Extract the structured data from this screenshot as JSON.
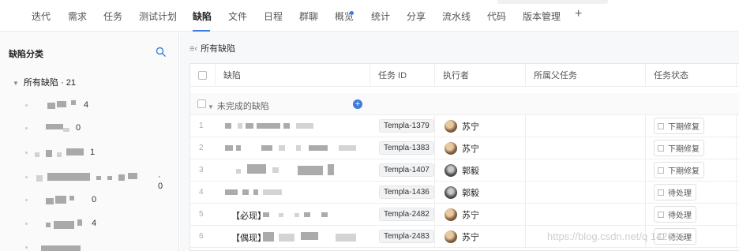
{
  "nav": {
    "tabs": [
      "迭代",
      "需求",
      "任务",
      "测试计划",
      "缺陷",
      "文件",
      "日程",
      "群聊",
      "概览",
      "统计",
      "分享",
      "流水线",
      "代码",
      "版本管理"
    ],
    "active_tab": "缺陷",
    "add_label": "+",
    "accent": "#3d7be0"
  },
  "sidebar": {
    "title": "缺陷分类",
    "all_label": "所有缺陷 · 21",
    "categories": [
      {
        "count": "4"
      },
      {
        "count": "0"
      },
      {
        "count": "1"
      },
      {
        "count": "· 0"
      },
      {
        "count": "0"
      },
      {
        "count": "4"
      }
    ]
  },
  "main": {
    "breadcrumb": "所有缺陷",
    "columns": [
      "缺陷",
      "任务 ID",
      "执行者",
      "所属父任务",
      "任务状态"
    ],
    "group_label": "未完成的缺陷",
    "rows": [
      {
        "index": "1",
        "title": "",
        "task_id": "Templa-1379",
        "assignee": "苏宁",
        "status": "下期修复"
      },
      {
        "index": "2",
        "title": "",
        "task_id": "Templa-1383",
        "assignee": "苏宁",
        "status": "下期修复"
      },
      {
        "index": "3",
        "title": "",
        "task_id": "Templa-1407",
        "assignee": "郭毅",
        "status": "下期修复"
      },
      {
        "index": "4",
        "title": "",
        "task_id": "Templa-1436",
        "assignee": "郭毅",
        "status": "待处理"
      },
      {
        "index": "5",
        "title": "【必现】",
        "task_id": "Templa-2482",
        "assignee": "苏宁",
        "status": "待处理"
      },
      {
        "index": "6",
        "title": "【偶现】",
        "task_id": "Templa-2483",
        "assignee": "苏宁",
        "status": "待处理"
      }
    ]
  },
  "watermark": "https://blog.csdn.net/q  142686"
}
